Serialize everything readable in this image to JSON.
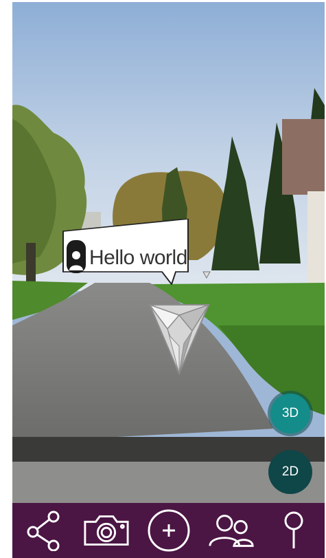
{
  "marker": {
    "label": "Hello world"
  },
  "mode_buttons": {
    "three_d": "3D",
    "two_d": "2D"
  },
  "toolbar": {
    "items": [
      {
        "icon": "share-icon"
      },
      {
        "icon": "camera-icon"
      },
      {
        "icon": "plus-circle-icon"
      },
      {
        "icon": "users-icon"
      },
      {
        "icon": "location-pin-icon"
      }
    ]
  },
  "colors": {
    "toolbar_bg": "#4b1544",
    "button_3d": "#138c8a",
    "button_2d": "#0f4648",
    "icon": "#ffffff"
  }
}
